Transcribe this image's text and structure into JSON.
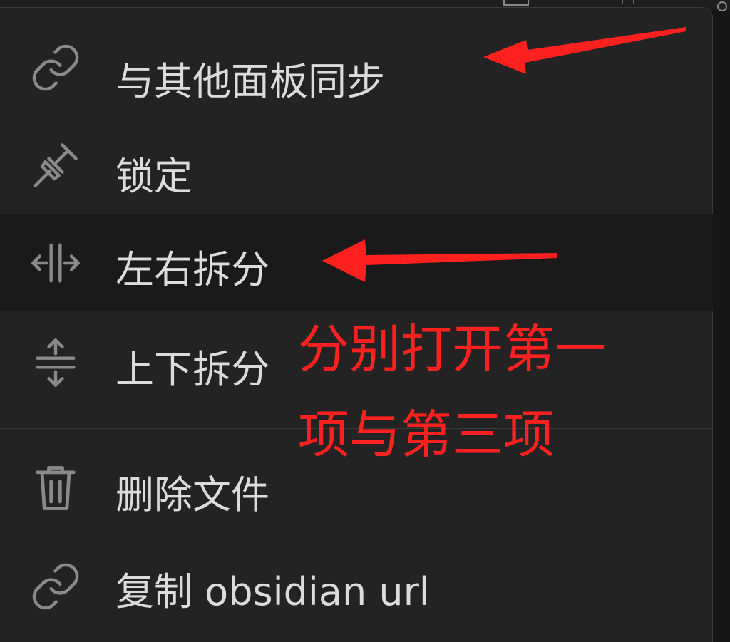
{
  "menu": {
    "items": [
      {
        "label": "与其他面板同步",
        "icon": "link-icon"
      },
      {
        "label": "锁定",
        "icon": "pin-icon"
      },
      {
        "label": "左右拆分",
        "icon": "split-vertical-icon"
      },
      {
        "label": "上下拆分",
        "icon": "split-horizontal-icon"
      },
      {
        "label": "删除文件",
        "icon": "trash-icon"
      },
      {
        "label": "复制 obsidian url",
        "icon": "link-icon"
      }
    ]
  },
  "annotation": {
    "line1": "分别打开第一",
    "line2": "项与第三项",
    "color": "#ff2020"
  },
  "colors": {
    "menu_bg": "#232323",
    "highlight_bg": "#1a1a1a",
    "text": "#dcdcdc",
    "icon": "#8a8a8a"
  }
}
